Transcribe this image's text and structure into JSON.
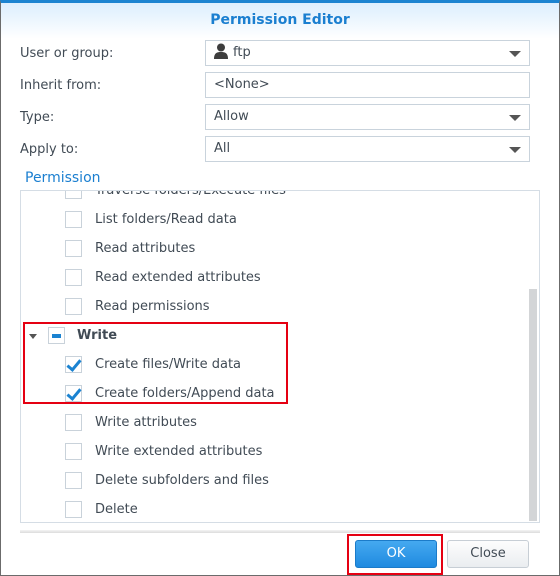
{
  "window": {
    "title": "Permission Editor"
  },
  "form": {
    "user_or_group": {
      "label": "User or group:",
      "value": "ftp",
      "icon": "user-icon"
    },
    "inherit_from": {
      "label": "Inherit from:",
      "value": "<None>"
    },
    "type": {
      "label": "Type:",
      "value": "Allow"
    },
    "apply_to": {
      "label": "Apply to:",
      "value": "All"
    }
  },
  "permission": {
    "section_title": "Permission",
    "items": [
      {
        "label": "Traverse folders/Execute files",
        "checked": false,
        "partially_visible": true
      },
      {
        "label": "List folders/Read data",
        "checked": false
      },
      {
        "label": "Read attributes",
        "checked": false
      },
      {
        "label": "Read extended attributes",
        "checked": false
      },
      {
        "label": "Read permissions",
        "checked": false
      },
      {
        "label": "Write",
        "group": true,
        "expanded": true,
        "state": "partial"
      },
      {
        "label": "Create files/Write data",
        "checked": true
      },
      {
        "label": "Create folders/Append data",
        "checked": true
      },
      {
        "label": "Write attributes",
        "checked": false
      },
      {
        "label": "Write extended attributes",
        "checked": false
      },
      {
        "label": "Delete subfolders and files",
        "checked": false
      },
      {
        "label": "Delete",
        "checked": false
      }
    ]
  },
  "buttons": {
    "ok": "OK",
    "close": "Close"
  },
  "colors": {
    "accent": "#1b83d1",
    "highlight": "#e50012"
  }
}
